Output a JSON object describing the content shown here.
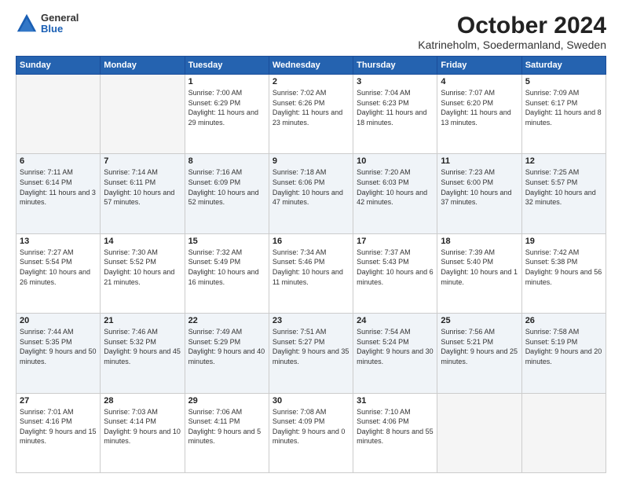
{
  "header": {
    "logo_general": "General",
    "logo_blue": "Blue",
    "title": "October 2024",
    "subtitle": "Katrineholm, Soedermanland, Sweden"
  },
  "days_of_week": [
    "Sunday",
    "Monday",
    "Tuesday",
    "Wednesday",
    "Thursday",
    "Friday",
    "Saturday"
  ],
  "weeks": [
    [
      {
        "day": "",
        "info": ""
      },
      {
        "day": "",
        "info": ""
      },
      {
        "day": "1",
        "info": "Sunrise: 7:00 AM\nSunset: 6:29 PM\nDaylight: 11 hours\nand 29 minutes."
      },
      {
        "day": "2",
        "info": "Sunrise: 7:02 AM\nSunset: 6:26 PM\nDaylight: 11 hours\nand 23 minutes."
      },
      {
        "day": "3",
        "info": "Sunrise: 7:04 AM\nSunset: 6:23 PM\nDaylight: 11 hours\nand 18 minutes."
      },
      {
        "day": "4",
        "info": "Sunrise: 7:07 AM\nSunset: 6:20 PM\nDaylight: 11 hours\nand 13 minutes."
      },
      {
        "day": "5",
        "info": "Sunrise: 7:09 AM\nSunset: 6:17 PM\nDaylight: 11 hours\nand 8 minutes."
      }
    ],
    [
      {
        "day": "6",
        "info": "Sunrise: 7:11 AM\nSunset: 6:14 PM\nDaylight: 11 hours\nand 3 minutes."
      },
      {
        "day": "7",
        "info": "Sunrise: 7:14 AM\nSunset: 6:11 PM\nDaylight: 10 hours\nand 57 minutes."
      },
      {
        "day": "8",
        "info": "Sunrise: 7:16 AM\nSunset: 6:09 PM\nDaylight: 10 hours\nand 52 minutes."
      },
      {
        "day": "9",
        "info": "Sunrise: 7:18 AM\nSunset: 6:06 PM\nDaylight: 10 hours\nand 47 minutes."
      },
      {
        "day": "10",
        "info": "Sunrise: 7:20 AM\nSunset: 6:03 PM\nDaylight: 10 hours\nand 42 minutes."
      },
      {
        "day": "11",
        "info": "Sunrise: 7:23 AM\nSunset: 6:00 PM\nDaylight: 10 hours\nand 37 minutes."
      },
      {
        "day": "12",
        "info": "Sunrise: 7:25 AM\nSunset: 5:57 PM\nDaylight: 10 hours\nand 32 minutes."
      }
    ],
    [
      {
        "day": "13",
        "info": "Sunrise: 7:27 AM\nSunset: 5:54 PM\nDaylight: 10 hours\nand 26 minutes."
      },
      {
        "day": "14",
        "info": "Sunrise: 7:30 AM\nSunset: 5:52 PM\nDaylight: 10 hours\nand 21 minutes."
      },
      {
        "day": "15",
        "info": "Sunrise: 7:32 AM\nSunset: 5:49 PM\nDaylight: 10 hours\nand 16 minutes."
      },
      {
        "day": "16",
        "info": "Sunrise: 7:34 AM\nSunset: 5:46 PM\nDaylight: 10 hours\nand 11 minutes."
      },
      {
        "day": "17",
        "info": "Sunrise: 7:37 AM\nSunset: 5:43 PM\nDaylight: 10 hours\nand 6 minutes."
      },
      {
        "day": "18",
        "info": "Sunrise: 7:39 AM\nSunset: 5:40 PM\nDaylight: 10 hours\nand 1 minute."
      },
      {
        "day": "19",
        "info": "Sunrise: 7:42 AM\nSunset: 5:38 PM\nDaylight: 9 hours\nand 56 minutes."
      }
    ],
    [
      {
        "day": "20",
        "info": "Sunrise: 7:44 AM\nSunset: 5:35 PM\nDaylight: 9 hours\nand 50 minutes."
      },
      {
        "day": "21",
        "info": "Sunrise: 7:46 AM\nSunset: 5:32 PM\nDaylight: 9 hours\nand 45 minutes."
      },
      {
        "day": "22",
        "info": "Sunrise: 7:49 AM\nSunset: 5:29 PM\nDaylight: 9 hours\nand 40 minutes."
      },
      {
        "day": "23",
        "info": "Sunrise: 7:51 AM\nSunset: 5:27 PM\nDaylight: 9 hours\nand 35 minutes."
      },
      {
        "day": "24",
        "info": "Sunrise: 7:54 AM\nSunset: 5:24 PM\nDaylight: 9 hours\nand 30 minutes."
      },
      {
        "day": "25",
        "info": "Sunrise: 7:56 AM\nSunset: 5:21 PM\nDaylight: 9 hours\nand 25 minutes."
      },
      {
        "day": "26",
        "info": "Sunrise: 7:58 AM\nSunset: 5:19 PM\nDaylight: 9 hours\nand 20 minutes."
      }
    ],
    [
      {
        "day": "27",
        "info": "Sunrise: 7:01 AM\nSunset: 4:16 PM\nDaylight: 9 hours\nand 15 minutes."
      },
      {
        "day": "28",
        "info": "Sunrise: 7:03 AM\nSunset: 4:14 PM\nDaylight: 9 hours\nand 10 minutes."
      },
      {
        "day": "29",
        "info": "Sunrise: 7:06 AM\nSunset: 4:11 PM\nDaylight: 9 hours\nand 5 minutes."
      },
      {
        "day": "30",
        "info": "Sunrise: 7:08 AM\nSunset: 4:09 PM\nDaylight: 9 hours\nand 0 minutes."
      },
      {
        "day": "31",
        "info": "Sunrise: 7:10 AM\nSunset: 4:06 PM\nDaylight: 8 hours\nand 55 minutes."
      },
      {
        "day": "",
        "info": ""
      },
      {
        "day": "",
        "info": ""
      }
    ]
  ]
}
